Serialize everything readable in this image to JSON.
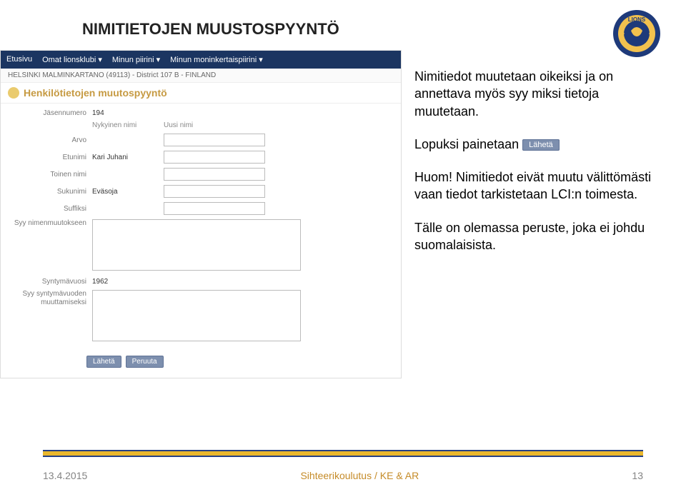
{
  "title": "NIMITIETOJEN MUUSTOSPYYNTÖ",
  "nav": {
    "items": [
      "Etusivu",
      "Omat lionsklubi ▾",
      "Minun piirini ▾",
      "Minun moninkertaispiirini ▾"
    ]
  },
  "breadcrumb": "HELSINKI MALMINKARTANO (49113) - District 107 B - FINLAND",
  "formTitle": "Henkilötietojen muutospyyntö",
  "form": {
    "memberNoLabel": "Jäsennumero",
    "memberNo": "194",
    "colCurrent": "Nykyinen nimi",
    "colNew": "Uusi nimi",
    "prefixLabel": "Arvo",
    "firstLabel": "Etunimi",
    "firstValue": "Kari Juhani",
    "middleLabel": "Toinen nimi",
    "lastLabel": "Sukunimi",
    "lastValue": "Eväsoja",
    "suffixLabel": "Suffiksi",
    "reasonLabel": "Syy nimenmuutokseen",
    "birthYearLabel": "Syntymävuosi",
    "birthYearValue": "1962",
    "birthReasonLabel": "Syy syntymävuoden muuttamiseksi"
  },
  "buttons": {
    "send": "Lähetä",
    "cancel": "Peruuta"
  },
  "body": {
    "p1": "Nimitiedot muutetaan oikeiksi ja on annettava myös syy miksi tietoja muutetaan.",
    "p2a": "Lopuksi painetaan",
    "p3": "Huom! Nimitiedot eivät muutu välittömästi vaan tiedot tarkistetaan LCI:n toimesta.",
    "p4": "Tälle on olemassa peruste, joka ei johdu suomalaisista."
  },
  "footer": {
    "left": "13.4.2015",
    "center": "Sihteerikoulutus / KE & AR",
    "right": "13"
  }
}
